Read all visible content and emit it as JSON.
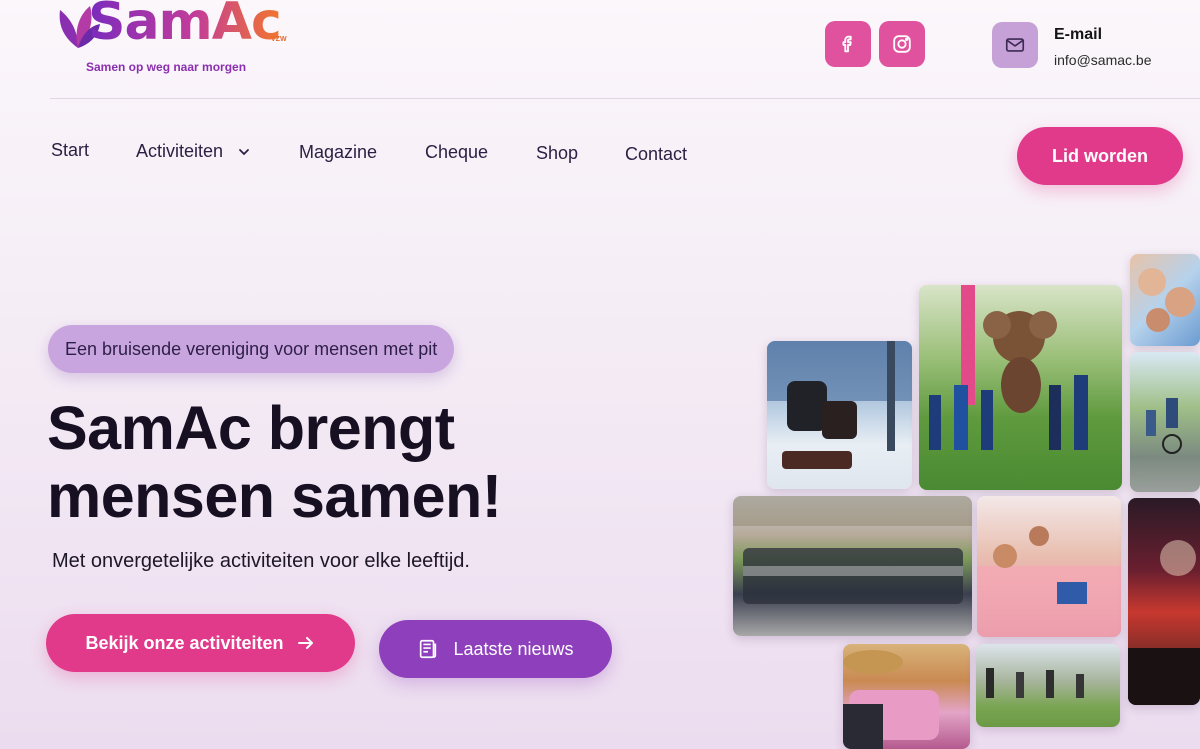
{
  "brand": {
    "name": "SamAc",
    "suffix": "VZW",
    "tagline": "Samen op weg naar morgen",
    "colors": {
      "primary": "#e23a8b",
      "secondary": "#8e3fbc",
      "accent": "#f2772c"
    }
  },
  "header": {
    "social": [
      {
        "name": "facebook",
        "icon": "facebook-icon"
      },
      {
        "name": "instagram",
        "icon": "instagram-icon"
      }
    ],
    "contact": {
      "icon": "mail-icon",
      "label": "E-mail",
      "value": "info@samac.be"
    }
  },
  "nav": {
    "items": [
      {
        "label": "Start"
      },
      {
        "label": "Activiteiten",
        "has_dropdown": true
      },
      {
        "label": "Magazine"
      },
      {
        "label": "Cheque"
      },
      {
        "label": "Shop"
      },
      {
        "label": "Contact"
      }
    ],
    "cta_label": "Lid worden"
  },
  "hero": {
    "tagline": "Een bruisende vereniging voor mensen met pit",
    "title_line1": "SamAc brengt",
    "title_line2": "mensen samen!",
    "subtitle": "Met onvergetelijke activiteiten voor elke leeftijd.",
    "primary_button": {
      "label": "Bekijk onze activiteiten",
      "icon": "arrow-right-icon"
    },
    "secondary_button": {
      "label": "Laatste nieuws",
      "icon": "newspaper-icon"
    }
  },
  "gallery": {
    "photos": [
      {
        "name": "photo-snow-sled"
      },
      {
        "name": "photo-mascot-children"
      },
      {
        "name": "photo-selfie"
      },
      {
        "name": "photo-cycling"
      },
      {
        "name": "photo-group-castle"
      },
      {
        "name": "photo-crafts-table"
      },
      {
        "name": "photo-concert"
      },
      {
        "name": "photo-hats-market"
      },
      {
        "name": "photo-field-walk"
      }
    ]
  }
}
